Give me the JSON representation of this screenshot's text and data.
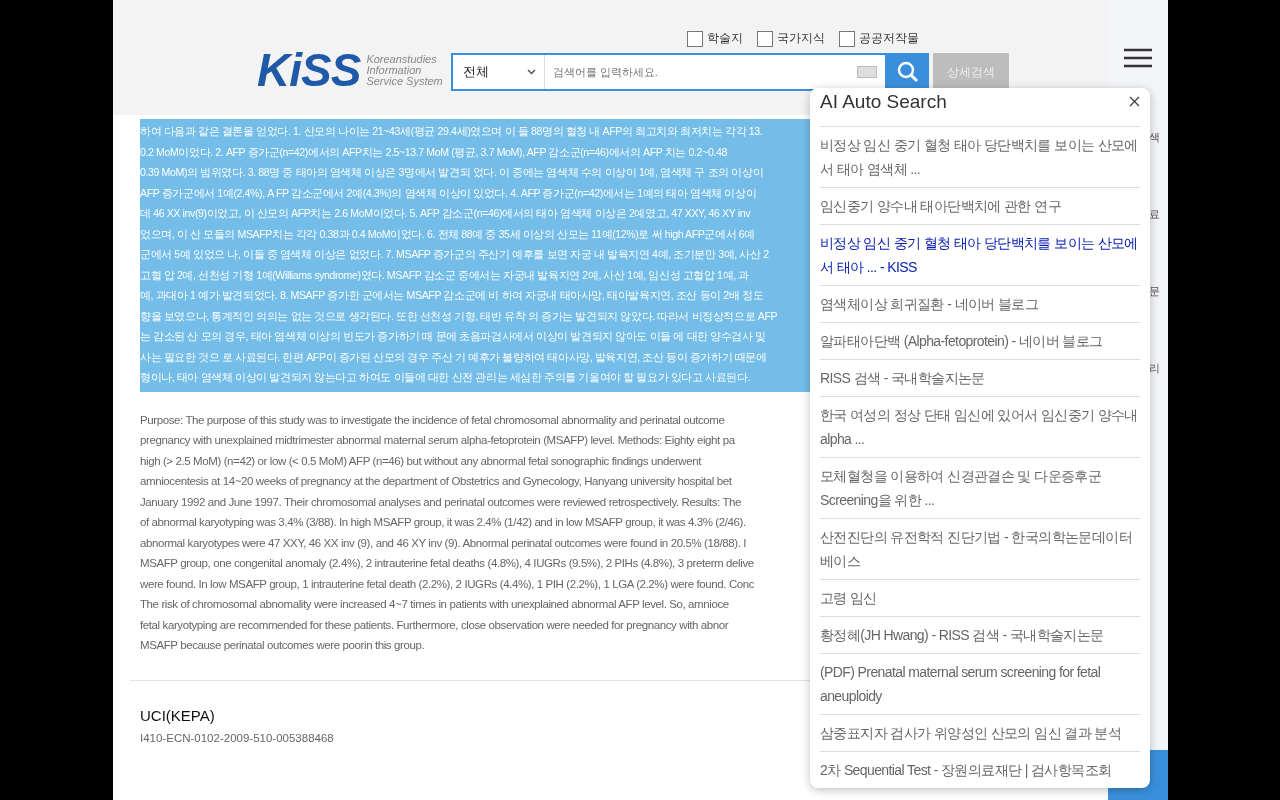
{
  "header": {
    "logo": {
      "mark": "KiSS",
      "tagline": [
        "Koreanstudies",
        "Information",
        "Service System"
      ]
    },
    "filters": [
      {
        "label": "학술지",
        "checked": false
      },
      {
        "label": "국가지식",
        "checked": false
      },
      {
        "label": "공공저작물",
        "checked": false
      }
    ],
    "scope": "전체",
    "search": {
      "placeholder": "검색어를 입력하세요."
    },
    "detail_button": "상세검색"
  },
  "abstract_ko": [
    "하여 다음과 같은 결론을 얻었다. 1. 산모의 나이는 21~43세(평균 29.4세)였으며 이 들 88명의 혈청 내 AFP의 최고치와 최저치는 각각 13.",
    "0.2 MoM이었다. 2. AFP 증가군(n=42)에서의 AFP치는 2.5~13.7 MoM (평균, 3.7 MoM), AFP 감소군(n=46)에서의 AFP 치는 0.2~0.48",
    "0.39 MoM)의 범위였다. 3. 88명 중 태아의 염색체 이상은 3명에서 발견되 었다. 이 중에는 염색체 수의 이상이 1예, 염색체 구 조의 이상이",
    "AFP 증가군에서 1예(2.4%), A FP 감소군에서 2예(4.3%)의 염색체 이상이 있었다. 4. AFP 증가군(n=42)에서는 1예의 태아 염색체 이상이",
    "데 46 XX inv(9)이었고, 이 산모의 AFP치는 2.6 MoM이었다. 5. AFP 감소군(n=46)에서의 태아 염색체 이상은 2예였고, 47 XXY, 46 XY inv",
    "었으며, 이 산 모들의 MSAFP치는 각각 0.38과 0.4 MoM이었다. 6. 전체 88예 중 35세 이상의 산모는 11예(12%)로 써 high AFP군에서 6예",
    "군에서 5예 있었으 나, 이들 중 염색체 이상은 없었다. 7. MSAFP 증가군의 주산기 예후를 보면 자궁 내 발육지연 4예, 조기분만 3예, 사산 2",
    "고혈 압 2예, 선천성 기형 1예(Williams syndrome)였다. MSAFP 감소군 중에서는 자궁내 발육지연 2예, 사산 1예, 임신성 고혈압 1예, 과",
    "예, 과대아 1 예가 발견되었다. 8. MSAFP 증가한 군에서는 MSAFP 감소군에 비 하여 자궁내 태아사망, 태아발육지연, 조산 등이 2배 정도",
    "향을 보였으나, 통계적인 의의는 없는 것으로 생각된다. 또한 선천성 기형, 태반 유착 의 증가는 발견되지 않았다. 따라서 비정상적으로 AFP",
    "는 감소된 산 모의 경우, 태아 염색체 이상의 빈도가 증가하기 때 문에 초음파검사에서 이상이 발견되지 않아도 이들 에 대한 양수검사 및",
    "사는 필요한 것으 로 사료된다. 한편 AFP이 증가된 산모의 경우 주산 기 예후가 불량하여 태아사망, 발육지연, 조산 등이 증가하기 때문에",
    "형이나, 태아 염색체 이상이 발견되지 않는다고 하여도 이들에 대한 산전 관리는 세심한 주의를 기울여야 할 필요가 있다고 사료된다."
  ],
  "abstract_en": [
    "Purpose: The purpose of this study was to investigate the incidence of fetal chromosomal abnormality and perinatal outcome",
    "pregnancy with unexplained midtrimester abnormal maternal serum alpha-fetoprotein (MSAFP) level. Methods: Eighty eight pa",
    "high (> 2.5 MoM) (n=42) or low (< 0.5 MoM) AFP (n=46) but without any abnormal fetal sonographic findings underwent",
    "amniocentesis at 14~20 weeks of pregnancy at the department of Obstetrics and Gynecology, Hanyang university hospital bet",
    "January 1992 and June 1997. Their chromosomal analyses and perinatal outcomes were reviewed retrospectively. Results: The",
    "of abnormal karyotyping was 3.4% (3/88). In high MSAFP group, it was 2.4% (1/42) and in low MSAFP group, it was 4.3% (2/46).",
    "abnormal karyotypes were 47 XXY, 46 XX inv (9), and 46 XY inv (9). Abnormal perinatal outcomes were found in 20.5% (18/88). I",
    "MSAFP group, one congenital anomaly (2.4%), 2 intrauterine fetal deaths (4.8%), 4 IUGRs (9.5%), 2 PIHs (4.8%), 3 preterm delive",
    "were found. In low MSAFP group, 1 intrauterine fetal death (2.2%), 2 IUGRs (4.4%), 1 PIH (2.2%), 1 LGA (2.2%) were found. Conc",
    "The risk of chromosomal abnomality were increased 4~7 times in patients with unexplained abnormal AFP level. So, amnioce",
    "fetal karyotyping are recommended for these patients. Furthermore, close observation were needed for pregnancy with abnor",
    "MSAFP because perinatal outcomes were poorin this group."
  ],
  "uci": {
    "title": "UCI(KEPA)",
    "value": "I410-ECN-0102-2009-510-005388468"
  },
  "quick_menu": [
    "색",
    "료",
    "문",
    "리"
  ],
  "popup": {
    "title": "AI Auto Search",
    "items": [
      {
        "text": "비정상 임신 중기 혈청 태아 당단백치를 보이는 산모에서 태아 염색체 ...",
        "selected": false
      },
      {
        "text": "임신중기 양수내 태아단백치에 관한 연구",
        "selected": false
      },
      {
        "text": "비정상 임신 중기 혈청 태아 당단백치를 보이는 산모에서 태아 ... - KISS",
        "selected": true
      },
      {
        "text": "염색체이상 희귀질환 - 네이버 블로그",
        "selected": false
      },
      {
        "text": "알파태아단백 (Alpha-fetoprotein) - 네이버 블로그",
        "selected": false
      },
      {
        "text": "RISS 검색 - 국내학술지논문",
        "selected": false
      },
      {
        "text": "한국 여성의 정상 단태 임신에 있어서 임신중기 양수내 alpha ...",
        "selected": false
      },
      {
        "text": "모체혈청을 이용하여 신경관결손 및 다운증후군 Screening을 위한 ...",
        "selected": false
      },
      {
        "text": "산전진단의 유전학적 진단기법 - 한국의학논문데이터베이스",
        "selected": false
      },
      {
        "text": "고령 임신",
        "selected": false
      },
      {
        "text": "황정혜(JH Hwang) - RISS 검색 - 국내학술지논문",
        "selected": false
      },
      {
        "text": "(PDF) Prenatal maternal serum screening for fetal aneuploidy",
        "selected": false
      },
      {
        "text": "삼중표지자 검사가 위양성인 산모의 임신 결과 분석",
        "selected": false
      },
      {
        "text": "2차 Sequential Test - 장원의료재단 | 검사항목조회",
        "selected": false
      }
    ]
  }
}
